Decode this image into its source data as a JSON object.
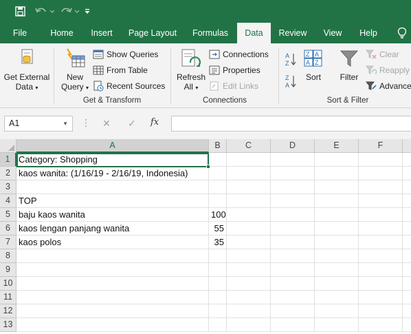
{
  "title_bar": {
    "quick_access": [
      "save-icon",
      "undo-icon",
      "redo-icon",
      "customize-icon"
    ]
  },
  "tabs": [
    {
      "label": "File",
      "active": false
    },
    {
      "label": "Home",
      "active": false
    },
    {
      "label": "Insert",
      "active": false
    },
    {
      "label": "Page Layout",
      "active": false
    },
    {
      "label": "Formulas",
      "active": false
    },
    {
      "label": "Data",
      "active": true
    },
    {
      "label": "Review",
      "active": false
    },
    {
      "label": "View",
      "active": false
    },
    {
      "label": "Help",
      "active": false
    }
  ],
  "ribbon": {
    "get_external": {
      "line1": "Get External",
      "line2": "Data"
    },
    "get_transform": {
      "group_label": "Get & Transform",
      "new_query": {
        "line1": "New",
        "line2": "Query"
      },
      "show_queries": "Show Queries",
      "from_table": "From Table",
      "recent_sources": "Recent Sources"
    },
    "connections": {
      "group_label": "Connections",
      "refresh": {
        "line1": "Refresh",
        "line2": "All"
      },
      "connections": "Connections",
      "properties": "Properties",
      "edit_links": "Edit Links"
    },
    "sort_filter": {
      "group_label": "Sort & Filter",
      "sort": "Sort",
      "filter": "Filter",
      "clear": "Clear",
      "reapply": "Reapply",
      "advanced": "Advanced"
    }
  },
  "formula_bar": {
    "name_box": "A1",
    "fx": "fx",
    "formula": ""
  },
  "grid": {
    "columns": [
      "A",
      "B",
      "C",
      "D",
      "E",
      "F"
    ],
    "rows": [
      "1",
      "2",
      "3",
      "4",
      "5",
      "6",
      "7",
      "8",
      "9",
      "10",
      "11",
      "12",
      "13"
    ],
    "selected_cell": "A1",
    "cells": {
      "A1": "Category: Shopping",
      "A2": "kaos wanita: (1/16/19 - 2/16/19, Indonesia)",
      "A4": "TOP",
      "A5": "baju kaos wanita",
      "B5": "100",
      "A6": "kaos lengan panjang wanita",
      "B6": "55",
      "A7": "kaos polos",
      "B7": "35"
    }
  },
  "colors": {
    "accent": "#217346",
    "ribbon_bg": "#f3f3f3",
    "header_bg": "#e6e6e6"
  }
}
